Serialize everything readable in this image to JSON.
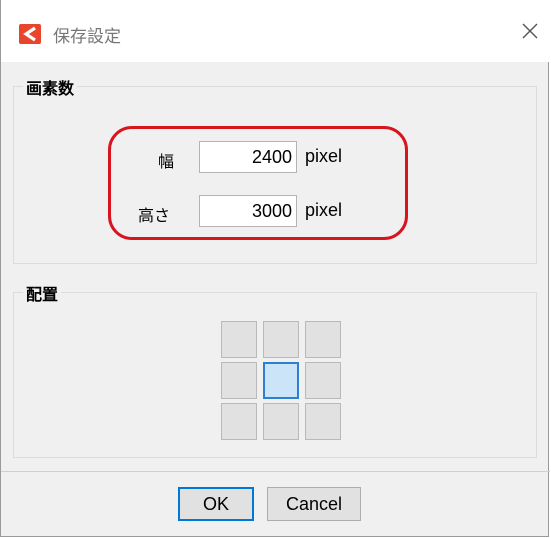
{
  "window": {
    "title": "保存設定"
  },
  "pixel_group": {
    "label": "画素数",
    "width": {
      "label": "幅",
      "value": "2400",
      "unit": "pixel"
    },
    "height": {
      "label": "高さ",
      "value": "3000",
      "unit": "pixel"
    }
  },
  "placement_group": {
    "label": "配置",
    "grid": {
      "rows": 3,
      "cols": 3,
      "selected": "center"
    }
  },
  "buttons": {
    "ok": "OK",
    "cancel": "Cancel"
  },
  "colors": {
    "highlight": "#d8141f",
    "selected_cell": "#cce4f7",
    "focus_border": "#0078d7",
    "app_icon": "#e8452c"
  },
  "icons": {
    "app": "app-logo-icon",
    "close": "close-icon"
  }
}
